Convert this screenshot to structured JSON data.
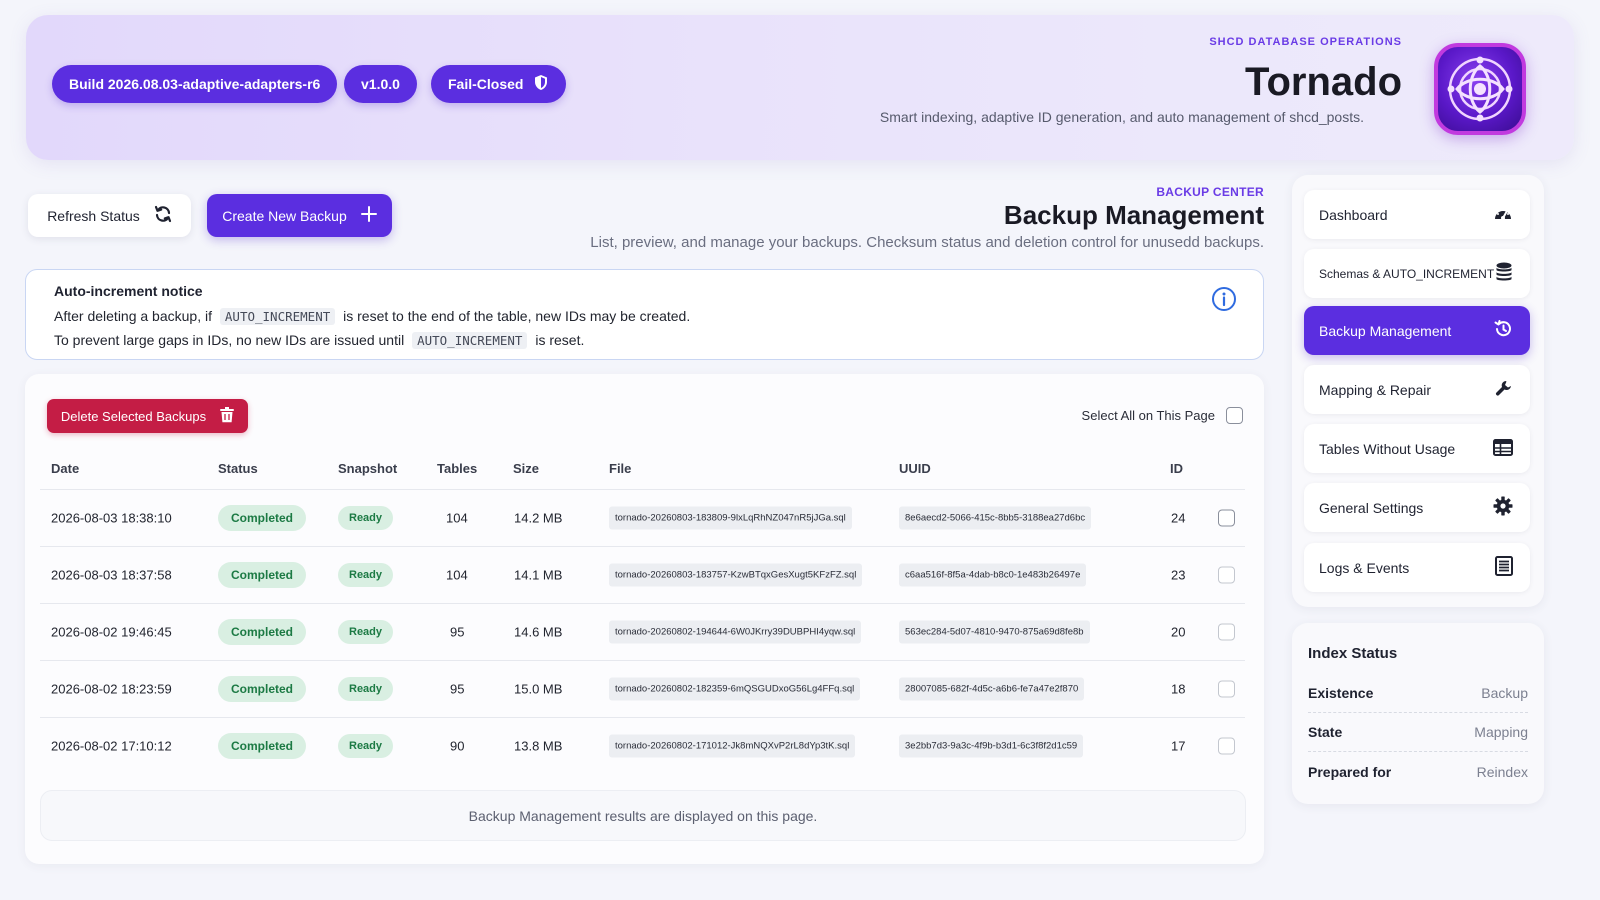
{
  "header": {
    "build": "Build 2026.08.03-adaptive-adapters-r6",
    "version": "v1.0.0",
    "mode": "Fail-Closed",
    "eyebrow": "SHCD DATABASE OPERATIONS",
    "title": "Tornado",
    "subtitle": "Smart indexing, adaptive ID generation, and auto management of shcd_posts."
  },
  "toolbar": {
    "refresh_label": "Refresh Status",
    "create_label": "Create New Backup"
  },
  "section": {
    "eyebrow": "BACKUP CENTER",
    "title": "Backup Management",
    "subtitle": "List, preview, and manage your backups. Checksum status and deletion control for unusedd backups."
  },
  "notice": {
    "title": "Auto-increment notice",
    "line1_a": "After deleting a backup, if",
    "line1_code": "AUTO_INCREMENT",
    "line1_b": "is reset to the end of the table, new IDs may be created.",
    "line2_a": "To prevent large gaps in IDs, no new IDs are issued until",
    "line2_code": "AUTO_INCREMENT",
    "line2_b": "is reset."
  },
  "table": {
    "delete_label": "Delete Selected Backups",
    "select_all_label": "Select All on This Page",
    "columns": [
      "Date",
      "Status",
      "Snapshot",
      "Tables",
      "Size",
      "File",
      "UUID",
      "ID"
    ],
    "rows": [
      {
        "date": "2026-08-03 18:38:10",
        "status": "Completed",
        "snapshot": "Ready",
        "tables": "104",
        "size": "14.2 MB",
        "file": "tornado-20260803-183809-9lxLqRhNZ047nR5jJGa.sql",
        "uuid": "8e6aecd2-5066-415c-8bb5-3188ea27d6bc",
        "id": "24"
      },
      {
        "date": "2026-08-03 18:37:58",
        "status": "Completed",
        "snapshot": "Ready",
        "tables": "104",
        "size": "14.1 MB",
        "file": "tornado-20260803-183757-KzwBTqxGesXugt5KFzFZ.sql",
        "uuid": "c6aa516f-8f5a-4dab-b8c0-1e483b26497e",
        "id": "23"
      },
      {
        "date": "2026-08-02 19:46:45",
        "status": "Completed",
        "snapshot": "Ready",
        "tables": "95",
        "size": "14.6 MB",
        "file": "tornado-20260802-194644-6W0JKrry39DUBPHI4yqw.sql",
        "uuid": "563ec284-5d07-4810-9470-875a69d8fe8b",
        "id": "20"
      },
      {
        "date": "2026-08-02 18:23:59",
        "status": "Completed",
        "snapshot": "Ready",
        "tables": "95",
        "size": "15.0 MB",
        "file": "tornado-20260802-182359-6mQSGUDxoG56Lg4FFq.sql",
        "uuid": "28007085-682f-4d5c-a6b6-fe7a47e2f870",
        "id": "18"
      },
      {
        "date": "2026-08-02 17:10:12",
        "status": "Completed",
        "snapshot": "Ready",
        "tables": "90",
        "size": "13.8 MB",
        "file": "tornado-20260802-171012-Jk8mNQXvP2rL8dYp3tK.sql",
        "uuid": "3e2bb7d3-9a3c-4f9b-b3d1-6c3f8f2d1c59",
        "id": "17"
      }
    ],
    "footer": "Backup Management results are displayed on this page."
  },
  "sidebar": {
    "items": [
      {
        "label": "Dashboard",
        "icon": "gauge-icon"
      },
      {
        "label": "Schemas & AUTO_INCREMENT",
        "icon": "database-icon"
      },
      {
        "label": "Backup Management",
        "icon": "history-icon"
      },
      {
        "label": "Mapping & Repair",
        "icon": "wrench-icon"
      },
      {
        "label": "Tables Without Usage",
        "icon": "table-icon"
      },
      {
        "label": "General Settings",
        "icon": "gear-icon"
      },
      {
        "label": "Logs & Events",
        "icon": "list-icon"
      }
    ]
  },
  "index_status": {
    "title": "Index Status",
    "rows": [
      {
        "key": "Existence",
        "value": "Backup"
      },
      {
        "key": "State",
        "value": "Mapping"
      },
      {
        "key": "Prepared for",
        "value": "Reindex"
      }
    ]
  },
  "colors": {
    "accent": "#5b2ee0",
    "danger": "#c41d45",
    "success_bg": "#d9efe2",
    "success_text": "#1c7a44"
  }
}
